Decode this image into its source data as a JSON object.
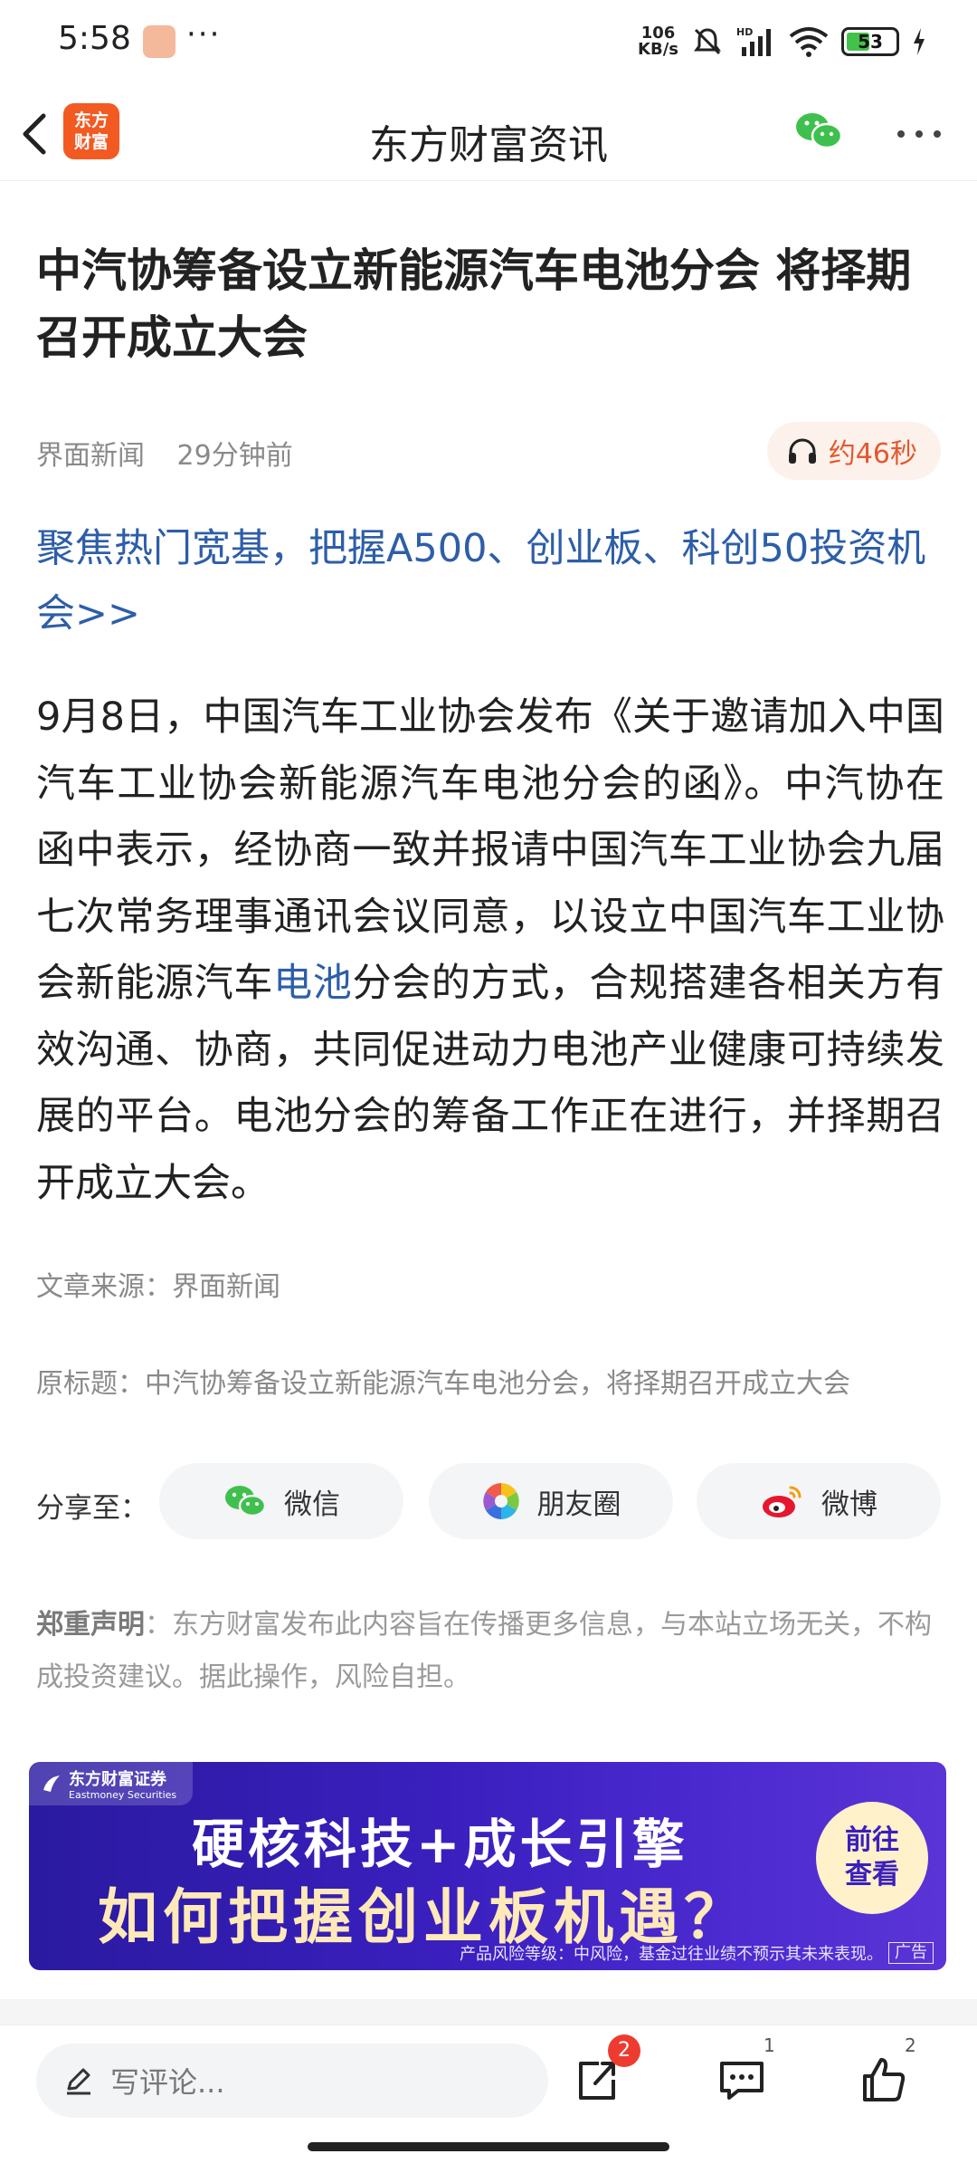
{
  "status": {
    "time": "5:58",
    "dots": "···",
    "net_speed_value": "106",
    "net_speed_unit": "KB/s",
    "battery": "53",
    "battery_level_percent": 53
  },
  "nav": {
    "logo_line1": "东方",
    "logo_line2": "财富",
    "title": "东方财富资讯"
  },
  "article": {
    "title": "中汽协筹备设立新能源汽车电池分会 将择期召开成立大会",
    "source": "界面新闻",
    "time_ago": "29分钟前",
    "listen_label": "约46秒",
    "promo_link": "聚焦热门宽基，把握A500、创业板、科创50投资机会>>",
    "body_before_link": "9月8日，中国汽车工业协会发布《关于邀请加入中国汽车工业协会新能源汽车电池分会的函》。中汽协在函中表示，经协商一致并报请中国汽车工业协会九届七次常务理事通讯会议同意，以设立中国汽车工业协会新能源汽车",
    "body_link": "电池",
    "body_after_link": "分会的方式，合规搭建各相关方有效沟通、协商，共同促进动力电池产业健康可持续发展的平台。电池分会的筹备工作正在进行，并择期召开成立大会。",
    "source_line": "文章来源：界面新闻",
    "original_title_line": "原标题：中汽协筹备设立新能源汽车电池分会，将择期召开成立大会"
  },
  "share": {
    "label": "分享至：",
    "wechat": "微信",
    "moments": "朋友圈",
    "weibo": "微博"
  },
  "disclaimer": {
    "bold": "郑重声明",
    "text": "：东方财富发布此内容旨在传播更多信息，与本站立场无关，不构成投资建议。据此操作，风险自担。"
  },
  "ad": {
    "brand": "东方财富证券",
    "brand_en": "Eastmoney Securities",
    "line1": "硬核科技+成长引擎",
    "line2": "如何把握创业板机遇？",
    "cta_line1": "前往",
    "cta_line2": "查看",
    "risk_text": "产品风险等级：中风险，基金过往业绩不预示其未来表现。",
    "tag": "广告"
  },
  "bottom_bar": {
    "comment_placeholder": "写评论...",
    "share_badge": "2",
    "comment_count": "1",
    "like_count": "2"
  },
  "colors": {
    "accent_orange": "#f25a22",
    "link_blue": "#2d5ea8",
    "wechat_green": "#3fc04e",
    "badge_red": "#ee3b30",
    "ad_purple": "#3a1fbe"
  }
}
